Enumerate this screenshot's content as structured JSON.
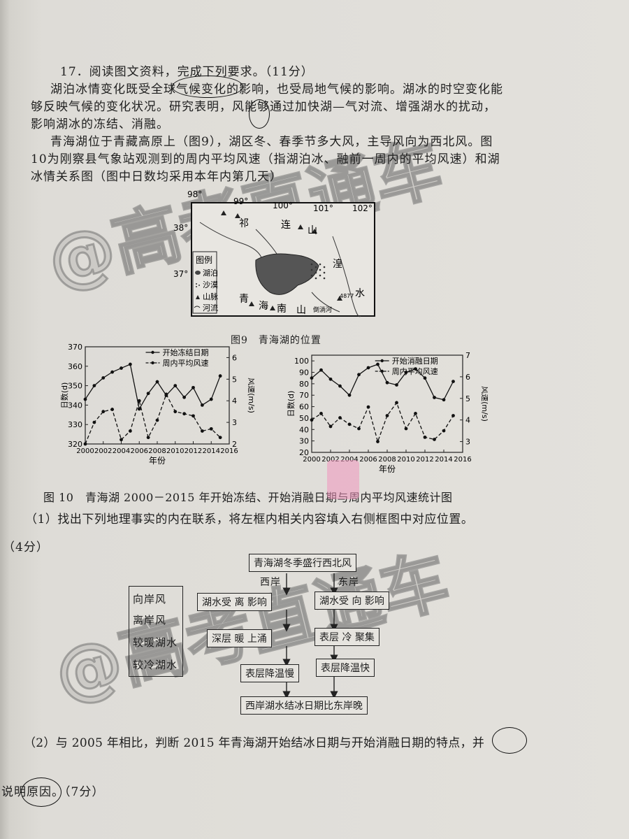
{
  "question": {
    "header": "17．阅读图文资料，完成下列要求。（11分）",
    "para1_line1": "湖泊冰情变化既受全球气候变化的影响，也受局地气候的影响。湖冰的时空变化能",
    "para1_line2": "够反映气候的变化状况。研究表明，风能够通过加快湖—气对流、增强湖水的扰动，",
    "para1_line3": "影响湖冰的冻结、消融。",
    "para2_line1": "青海湖位于青藏高原上（图9），湖区冬、春季节多大风，主导风向为西北风。图",
    "para2_line2": "10为刚察县气象站观测到的周内平均风速（指湖泊冰、融前一周内的平均风速）和湖",
    "para2_line3": "冰情关系图（图中日数均采用本年内第几天）"
  },
  "map": {
    "caption": "图9　青海湖的位置",
    "lon_labels": [
      "98°",
      "99°",
      "100°",
      "101°",
      "102°"
    ],
    "lat_labels": [
      "38°",
      "37°"
    ],
    "place_labels": [
      "祁",
      "连",
      "山",
      "湟",
      "水",
      "青",
      "海",
      "南",
      "山",
      "倒淌河",
      "4877"
    ],
    "legend_title": "图例",
    "legend_items": [
      "湖泊",
      "沙漠",
      "山脉",
      "河流"
    ]
  },
  "fig10_caption": "图 10　青海湖 2000－2015 年开始冻结、开始消融日期与周内平均风速统计图",
  "part1": {
    "prompt": "（1）找出下列地理事实的内在联系，将左框内相关内容填入右侧框图中对应位置。",
    "score": "（4分）",
    "options": [
      "向岸风",
      "离岸风",
      "较暖湖水",
      "较冷湖水"
    ],
    "top_box": "青海湖冬季盛行西北风",
    "west_label": "西岸",
    "east_label": "东岸",
    "west_influence": "湖水受 离 影响",
    "east_influence": "湖水受 向 影响",
    "west_deep": "深层 暖 上涌",
    "east_surface": "表层 冷 聚集",
    "west_cool": "表层降温慢",
    "east_cool": "表层降温快",
    "bottom_box": "西岸湖水结冰日期比东岸晚",
    "handwriting": [
      "离",
      "向",
      "暖",
      "冷"
    ]
  },
  "part2": {
    "line1": "（2）与 2005 年相比，判断 2015 年青海湖开始结冰日期与开始消融日期的特点，并",
    "line2": "说明原因。（7分）"
  },
  "watermark": "@高考直通车",
  "chart_data": [
    {
      "type": "line",
      "title": "",
      "x": [
        2000,
        2001,
        2002,
        2003,
        2004,
        2005,
        2006,
        2007,
        2008,
        2009,
        2010,
        2011,
        2012,
        2013,
        2014,
        2015
      ],
      "xlabel": "年份",
      "ylabel": "日数(d)",
      "y2label": "风速(m/s)",
      "ylim": [
        320,
        370
      ],
      "y2lim": [
        2,
        6.5
      ],
      "xticks": [
        2000,
        2002,
        2004,
        2006,
        2008,
        2010,
        2012,
        2014,
        2016
      ],
      "yticks": [
        320,
        330,
        340,
        350,
        360,
        370
      ],
      "y2ticks": [
        2,
        3,
        4,
        5,
        6
      ],
      "legend_position": "top-right",
      "series": [
        {
          "name": "开始冻结日期",
          "axis": "left",
          "style": "solid",
          "values": [
            343,
            350,
            354,
            357,
            359,
            361,
            338,
            346,
            352,
            345,
            350,
            344,
            349,
            340,
            343,
            355
          ]
        },
        {
          "name": "周内平均风速",
          "axis": "right",
          "style": "dashed",
          "values": [
            2.0,
            3.0,
            3.5,
            3.6,
            2.2,
            2.6,
            4.0,
            2.3,
            3.1,
            4.3,
            3.5,
            3.4,
            3.3,
            2.6,
            2.7,
            2.3
          ]
        }
      ]
    },
    {
      "type": "line",
      "title": "",
      "x": [
        2000,
        2001,
        2002,
        2003,
        2004,
        2005,
        2006,
        2007,
        2008,
        2009,
        2010,
        2011,
        2012,
        2013,
        2014,
        2015
      ],
      "xlabel": "年份",
      "ylabel": "日数(d)",
      "y2label": "风速(m/s)",
      "ylim": [
        20,
        105
      ],
      "y2lim": [
        2.5,
        7
      ],
      "xticks": [
        2000,
        2002,
        2004,
        2006,
        2008,
        2010,
        2012,
        2014,
        2016
      ],
      "yticks": [
        20,
        30,
        40,
        50,
        60,
        70,
        80,
        90,
        100
      ],
      "y2ticks": [
        3,
        4,
        5,
        6,
        7
      ],
      "legend_position": "top-right",
      "series": [
        {
          "name": "开始消融日期",
          "axis": "left",
          "style": "solid",
          "values": [
            85,
            92,
            84,
            78,
            70,
            88,
            94,
            97,
            81,
            79,
            90,
            93,
            85,
            68,
            66,
            82
          ]
        },
        {
          "name": "周内平均风速",
          "axis": "right",
          "style": "dashed",
          "values": [
            4.0,
            4.3,
            3.7,
            4.1,
            3.8,
            3.6,
            4.6,
            3.0,
            4.2,
            4.8,
            3.6,
            4.3,
            3.2,
            3.1,
            3.5,
            4.2
          ]
        }
      ]
    }
  ]
}
